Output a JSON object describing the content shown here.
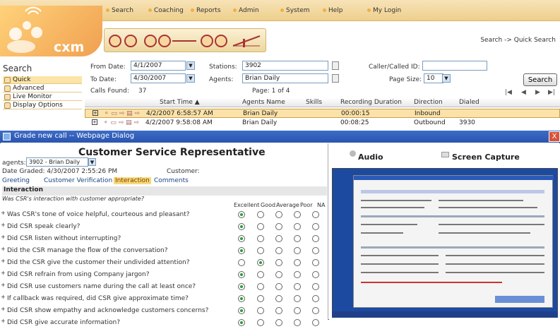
{
  "nav": {
    "items": [
      "Search",
      "Coaching",
      "Reports",
      "Admin",
      "System",
      "Help",
      "My Login"
    ]
  },
  "logo": {
    "text": "cxm"
  },
  "breadcrumb": "Search -> Quick Search",
  "sidebar": {
    "title": "Search",
    "items": [
      {
        "label": "Quick",
        "selected": true
      },
      {
        "label": "Advanced",
        "selected": false
      },
      {
        "label": "Live Monitor",
        "selected": false
      },
      {
        "label": "Display Options",
        "selected": false
      }
    ]
  },
  "form": {
    "from_date_label": "From Date:",
    "from_date": "4/1/2007",
    "to_date_label": "To Date:",
    "to_date": "4/30/2007",
    "stations_label": "Stations:",
    "stations": "3902",
    "agents_label": "Agents:",
    "agents": "Brian Daily",
    "caller_label": "Caller/Called ID:",
    "caller": "",
    "page_size_label": "Page Size:",
    "page_size": "10",
    "calls_found_label": "Calls Found:",
    "calls_found": "37",
    "page_label": "Page: 1 of 4",
    "search_button": "Search",
    "pager": [
      "|◀",
      "◀",
      "▶",
      "▶|"
    ]
  },
  "grid": {
    "headers": [
      "Start Time ▲",
      "Agents Name",
      "Skills",
      "Recording Duration",
      "Direction",
      "Dialed"
    ],
    "rows": [
      {
        "start": "4/2/2007 6:58:57 AM",
        "agent": "Brian Daily",
        "skills": "",
        "duration": "00:00:15",
        "direction": "Inbound",
        "dialed": ""
      },
      {
        "start": "4/2/2007 9:58:08 AM",
        "agent": "Brian Daily",
        "skills": "",
        "duration": "00:08:25",
        "direction": "Outbound",
        "dialed": "3930"
      }
    ]
  },
  "dialog": {
    "title": "Grade new call -- Webpage Dialog",
    "close": "X",
    "form_title": "Customer Service Representative",
    "agents_label": "agents:",
    "agents_value": "3902 - Brian Daily",
    "date_graded": "Date Graded: 4/30/2007 2:55:26 PM",
    "customer_label": "Customer:",
    "tabs": [
      {
        "label": "Greeting",
        "active": false
      },
      {
        "label": "Customer Verification",
        "active": false
      },
      {
        "label": "Interaction",
        "active": true
      },
      {
        "label": "Comments",
        "active": false
      }
    ],
    "section_title": "Interaction",
    "section_question": "Was CSR's interaction with customer appropriate?",
    "scale": [
      "Excellent",
      "Good",
      "Average",
      "Poor",
      "NA"
    ],
    "questions": [
      {
        "text": "Was CSR's tone of voice helpful, courteous and pleasant?",
        "selected": 0
      },
      {
        "text": "Did CSR speak clearly?",
        "selected": 0
      },
      {
        "text": "Did CSR listen without interrupting?",
        "selected": 0
      },
      {
        "text": "Did the CSR manage the flow of the conversation?",
        "selected": 0
      },
      {
        "text": "Did the CSR give the customer their undivided attention?",
        "selected": 1
      },
      {
        "text": "Did CSR refrain from using Company jargon?",
        "selected": 0
      },
      {
        "text": "Did CSR use customers name during the call at least once?",
        "selected": 0
      },
      {
        "text": "If callback was required, did CSR give approximate time?",
        "selected": 0
      },
      {
        "text": "Did CSR show empathy and acknowledge customers concerns?",
        "selected": 0
      },
      {
        "text": "Did CSR give accurate information?",
        "selected": 0
      }
    ],
    "audio_label": "Audio",
    "screen_label": "Screen Capture"
  },
  "colors": {
    "accent": "#f0a050",
    "selected_row": "#fbe2a8",
    "dialog_title": "#2a55b0",
    "tab_active": "#f8d97b"
  }
}
